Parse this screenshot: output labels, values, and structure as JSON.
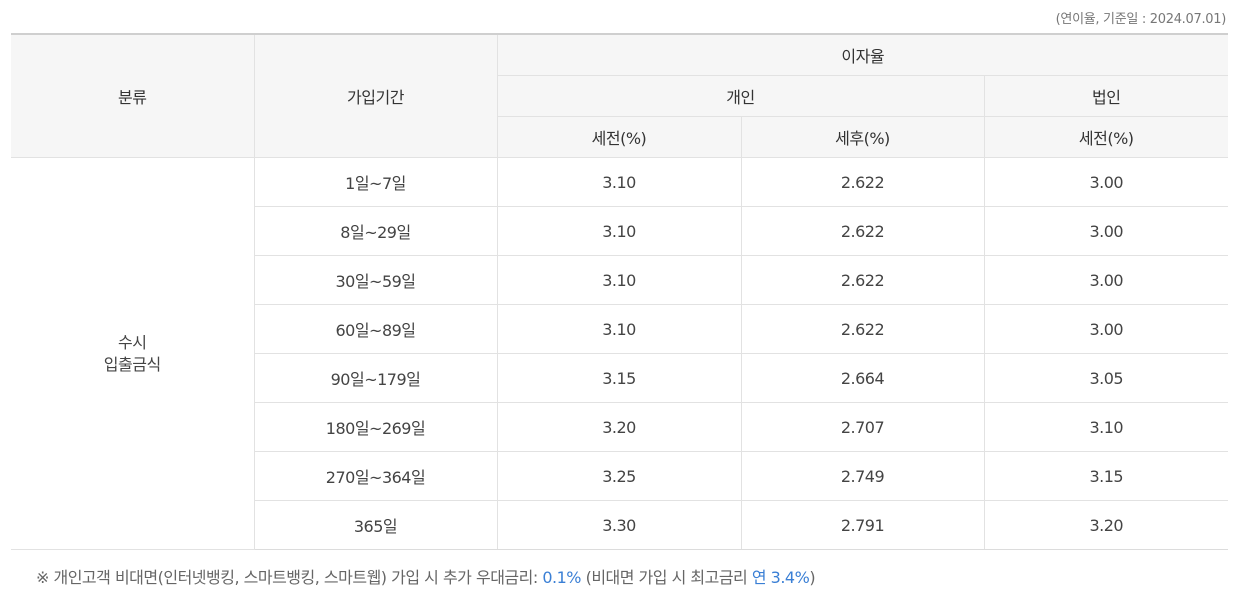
{
  "meta_label": "(연이율, 기준일 : 2024.07.01)",
  "headers": {
    "category": "분류",
    "term": "가입기간",
    "rate": "이자율",
    "individual": "개인",
    "corporate": "법인",
    "pre_tax_individual": "세전(%)",
    "after_tax_individual": "세후(%)",
    "pre_tax_corporate": "세전(%)"
  },
  "category_lines": [
    "수시",
    "입출금식"
  ],
  "rows": [
    {
      "term": "1일~7일",
      "pre": "3.10",
      "after": "2.622",
      "corp": "3.00"
    },
    {
      "term": "8일~29일",
      "pre": "3.10",
      "after": "2.622",
      "corp": "3.00"
    },
    {
      "term": "30일~59일",
      "pre": "3.10",
      "after": "2.622",
      "corp": "3.00"
    },
    {
      "term": "60일~89일",
      "pre": "3.10",
      "after": "2.622",
      "corp": "3.00"
    },
    {
      "term": "90일~179일",
      "pre": "3.15",
      "after": "2.664",
      "corp": "3.05"
    },
    {
      "term": "180일~269일",
      "pre": "3.20",
      "after": "2.707",
      "corp": "3.10"
    },
    {
      "term": "270일~364일",
      "pre": "3.25",
      "after": "2.749",
      "corp": "3.15"
    },
    {
      "term": "365일",
      "pre": "3.30",
      "after": "2.791",
      "corp": "3.20"
    }
  ],
  "note": {
    "prefix": "※ 개인고객 비대면(인터넷뱅킹, 스마트뱅킹, 스마트웹) 가입 시 추가 우대금리: ",
    "extra_rate": "0.1%",
    "middle": " (비대면 가입 시 최고금리 ",
    "max_rate": "연 3.4%",
    "suffix": ")"
  },
  "colors": {
    "highlight": "#3a7fd5",
    "header_bg": "#f6f6f6"
  }
}
